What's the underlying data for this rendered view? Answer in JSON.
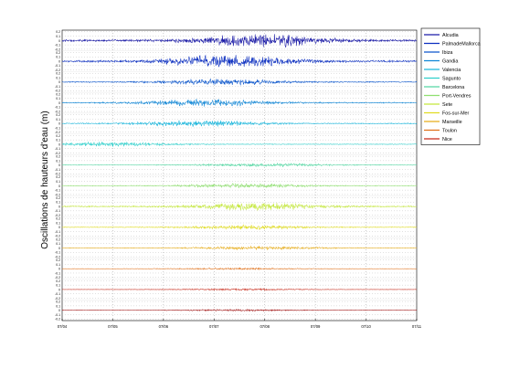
{
  "chart_data": {
    "type": "line",
    "title": "",
    "ylabel": "Oscillations de hauteurs d'eau (m)",
    "xlabel": "",
    "x_ticks": [
      "07/04",
      "07/05",
      "07/06",
      "07/07",
      "07/08",
      "07/09",
      "07/10",
      "07/11"
    ],
    "x_range": [
      "07/04",
      "07/11"
    ],
    "panel_ylim": [
      -0.2,
      0.2
    ],
    "y_ticks": [
      "0.2",
      "0.1",
      "0",
      "-0.1",
      "-0.2"
    ],
    "grid": true,
    "grid_style": "dotted",
    "legend_position": "top-right outside",
    "series": [
      {
        "name": "Alcudia",
        "color": "#1a1aa6",
        "peak_amplitude": 0.15,
        "peak_day": 3.9
      },
      {
        "name": "PalmadeMallorca",
        "color": "#0c2fc0",
        "peak_amplitude": 0.14,
        "peak_day": 3.3
      },
      {
        "name": "Ibiza",
        "color": "#0a55cc",
        "peak_amplitude": 0.07,
        "peak_day": 3.2
      },
      {
        "name": "Gandia",
        "color": "#0f86d6",
        "peak_amplitude": 0.08,
        "peak_day": 2.9
      },
      {
        "name": "Valencia",
        "color": "#1ab6dc",
        "peak_amplitude": 0.07,
        "peak_day": 2.7
      },
      {
        "name": "Sagunto",
        "color": "#2fd0cc",
        "peak_amplitude": 0.05,
        "peak_day": 1.0
      },
      {
        "name": "Barcelona",
        "color": "#55d8a3",
        "peak_amplitude": 0.04,
        "peak_day": 4.0
      },
      {
        "name": "Port-Vendres",
        "color": "#8fe070",
        "peak_amplitude": 0.05,
        "peak_day": 3.6
      },
      {
        "name": "Sete",
        "color": "#c4e83a",
        "peak_amplitude": 0.09,
        "peak_day": 3.9
      },
      {
        "name": "Fos-sur-Mer",
        "color": "#e0dc20",
        "peak_amplitude": 0.05,
        "peak_day": 3.7
      },
      {
        "name": "Marseille",
        "color": "#e8ad1a",
        "peak_amplitude": 0.04,
        "peak_day": 3.9
      },
      {
        "name": "Toulon",
        "color": "#e07018",
        "peak_amplitude": 0.02,
        "peak_day": 3.5
      },
      {
        "name": "Nice",
        "color": "#c82818",
        "peak_amplitude": 0.02,
        "peak_day": 3.5
      }
    ],
    "extra_trace_color": "#a01010"
  }
}
